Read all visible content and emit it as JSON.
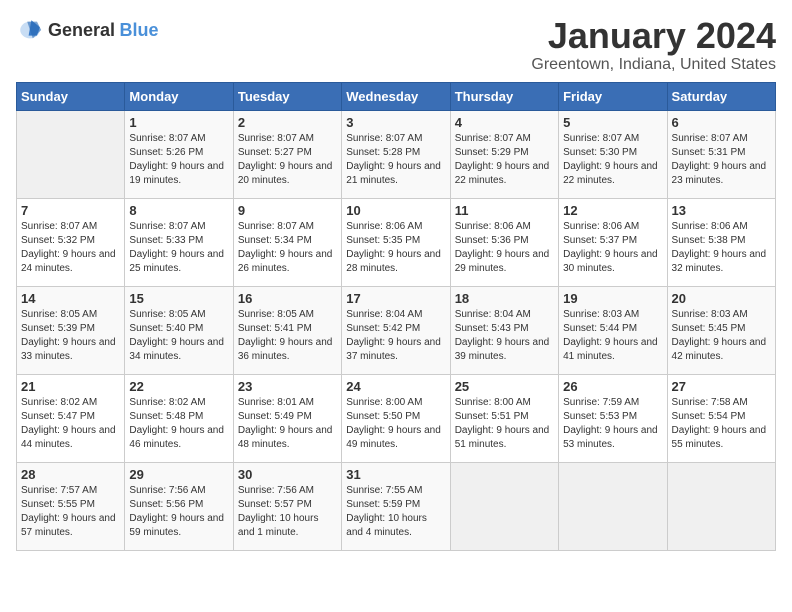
{
  "logo": {
    "general": "General",
    "blue": "Blue"
  },
  "header": {
    "title": "January 2024",
    "subtitle": "Greentown, Indiana, United States"
  },
  "days_of_week": [
    "Sunday",
    "Monday",
    "Tuesday",
    "Wednesday",
    "Thursday",
    "Friday",
    "Saturday"
  ],
  "weeks": [
    [
      {
        "day": "",
        "sunrise": "",
        "sunset": "",
        "daylight": ""
      },
      {
        "day": "1",
        "sunrise": "Sunrise: 8:07 AM",
        "sunset": "Sunset: 5:26 PM",
        "daylight": "Daylight: 9 hours and 19 minutes."
      },
      {
        "day": "2",
        "sunrise": "Sunrise: 8:07 AM",
        "sunset": "Sunset: 5:27 PM",
        "daylight": "Daylight: 9 hours and 20 minutes."
      },
      {
        "day": "3",
        "sunrise": "Sunrise: 8:07 AM",
        "sunset": "Sunset: 5:28 PM",
        "daylight": "Daylight: 9 hours and 21 minutes."
      },
      {
        "day": "4",
        "sunrise": "Sunrise: 8:07 AM",
        "sunset": "Sunset: 5:29 PM",
        "daylight": "Daylight: 9 hours and 22 minutes."
      },
      {
        "day": "5",
        "sunrise": "Sunrise: 8:07 AM",
        "sunset": "Sunset: 5:30 PM",
        "daylight": "Daylight: 9 hours and 22 minutes."
      },
      {
        "day": "6",
        "sunrise": "Sunrise: 8:07 AM",
        "sunset": "Sunset: 5:31 PM",
        "daylight": "Daylight: 9 hours and 23 minutes."
      }
    ],
    [
      {
        "day": "7",
        "sunrise": "Sunrise: 8:07 AM",
        "sunset": "Sunset: 5:32 PM",
        "daylight": "Daylight: 9 hours and 24 minutes."
      },
      {
        "day": "8",
        "sunrise": "Sunrise: 8:07 AM",
        "sunset": "Sunset: 5:33 PM",
        "daylight": "Daylight: 9 hours and 25 minutes."
      },
      {
        "day": "9",
        "sunrise": "Sunrise: 8:07 AM",
        "sunset": "Sunset: 5:34 PM",
        "daylight": "Daylight: 9 hours and 26 minutes."
      },
      {
        "day": "10",
        "sunrise": "Sunrise: 8:06 AM",
        "sunset": "Sunset: 5:35 PM",
        "daylight": "Daylight: 9 hours and 28 minutes."
      },
      {
        "day": "11",
        "sunrise": "Sunrise: 8:06 AM",
        "sunset": "Sunset: 5:36 PM",
        "daylight": "Daylight: 9 hours and 29 minutes."
      },
      {
        "day": "12",
        "sunrise": "Sunrise: 8:06 AM",
        "sunset": "Sunset: 5:37 PM",
        "daylight": "Daylight: 9 hours and 30 minutes."
      },
      {
        "day": "13",
        "sunrise": "Sunrise: 8:06 AM",
        "sunset": "Sunset: 5:38 PM",
        "daylight": "Daylight: 9 hours and 32 minutes."
      }
    ],
    [
      {
        "day": "14",
        "sunrise": "Sunrise: 8:05 AM",
        "sunset": "Sunset: 5:39 PM",
        "daylight": "Daylight: 9 hours and 33 minutes."
      },
      {
        "day": "15",
        "sunrise": "Sunrise: 8:05 AM",
        "sunset": "Sunset: 5:40 PM",
        "daylight": "Daylight: 9 hours and 34 minutes."
      },
      {
        "day": "16",
        "sunrise": "Sunrise: 8:05 AM",
        "sunset": "Sunset: 5:41 PM",
        "daylight": "Daylight: 9 hours and 36 minutes."
      },
      {
        "day": "17",
        "sunrise": "Sunrise: 8:04 AM",
        "sunset": "Sunset: 5:42 PM",
        "daylight": "Daylight: 9 hours and 37 minutes."
      },
      {
        "day": "18",
        "sunrise": "Sunrise: 8:04 AM",
        "sunset": "Sunset: 5:43 PM",
        "daylight": "Daylight: 9 hours and 39 minutes."
      },
      {
        "day": "19",
        "sunrise": "Sunrise: 8:03 AM",
        "sunset": "Sunset: 5:44 PM",
        "daylight": "Daylight: 9 hours and 41 minutes."
      },
      {
        "day": "20",
        "sunrise": "Sunrise: 8:03 AM",
        "sunset": "Sunset: 5:45 PM",
        "daylight": "Daylight: 9 hours and 42 minutes."
      }
    ],
    [
      {
        "day": "21",
        "sunrise": "Sunrise: 8:02 AM",
        "sunset": "Sunset: 5:47 PM",
        "daylight": "Daylight: 9 hours and 44 minutes."
      },
      {
        "day": "22",
        "sunrise": "Sunrise: 8:02 AM",
        "sunset": "Sunset: 5:48 PM",
        "daylight": "Daylight: 9 hours and 46 minutes."
      },
      {
        "day": "23",
        "sunrise": "Sunrise: 8:01 AM",
        "sunset": "Sunset: 5:49 PM",
        "daylight": "Daylight: 9 hours and 48 minutes."
      },
      {
        "day": "24",
        "sunrise": "Sunrise: 8:00 AM",
        "sunset": "Sunset: 5:50 PM",
        "daylight": "Daylight: 9 hours and 49 minutes."
      },
      {
        "day": "25",
        "sunrise": "Sunrise: 8:00 AM",
        "sunset": "Sunset: 5:51 PM",
        "daylight": "Daylight: 9 hours and 51 minutes."
      },
      {
        "day": "26",
        "sunrise": "Sunrise: 7:59 AM",
        "sunset": "Sunset: 5:53 PM",
        "daylight": "Daylight: 9 hours and 53 minutes."
      },
      {
        "day": "27",
        "sunrise": "Sunrise: 7:58 AM",
        "sunset": "Sunset: 5:54 PM",
        "daylight": "Daylight: 9 hours and 55 minutes."
      }
    ],
    [
      {
        "day": "28",
        "sunrise": "Sunrise: 7:57 AM",
        "sunset": "Sunset: 5:55 PM",
        "daylight": "Daylight: 9 hours and 57 minutes."
      },
      {
        "day": "29",
        "sunrise": "Sunrise: 7:56 AM",
        "sunset": "Sunset: 5:56 PM",
        "daylight": "Daylight: 9 hours and 59 minutes."
      },
      {
        "day": "30",
        "sunrise": "Sunrise: 7:56 AM",
        "sunset": "Sunset: 5:57 PM",
        "daylight": "Daylight: 10 hours and 1 minute."
      },
      {
        "day": "31",
        "sunrise": "Sunrise: 7:55 AM",
        "sunset": "Sunset: 5:59 PM",
        "daylight": "Daylight: 10 hours and 4 minutes."
      },
      {
        "day": "",
        "sunrise": "",
        "sunset": "",
        "daylight": ""
      },
      {
        "day": "",
        "sunrise": "",
        "sunset": "",
        "daylight": ""
      },
      {
        "day": "",
        "sunrise": "",
        "sunset": "",
        "daylight": ""
      }
    ]
  ]
}
